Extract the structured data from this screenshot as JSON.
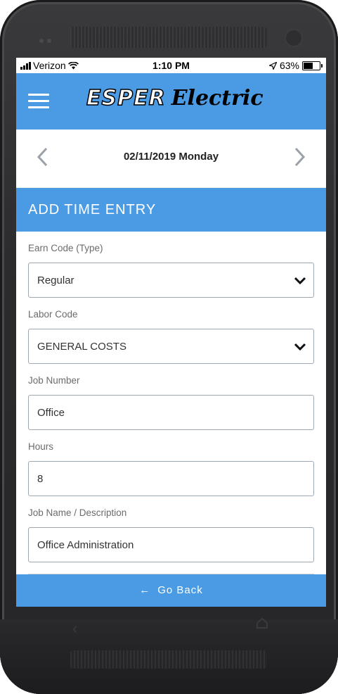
{
  "status_bar": {
    "carrier": "Verizon",
    "time": "1:10 PM",
    "battery_percent": "63%",
    "battery_level": 0.63
  },
  "header": {
    "logo_word1": "ESPER",
    "logo_word2": "Electric",
    "menu_icon": "hamburger-menu-icon",
    "accent_color": "#4a9be3"
  },
  "date_nav": {
    "date": "02/11/2019 Monday",
    "prev_icon": "chevron-left-icon",
    "next_icon": "chevron-right-icon"
  },
  "section": {
    "title": "ADD TIME ENTRY"
  },
  "form": {
    "earn_code": {
      "label": "Earn Code (Type)",
      "value": "Regular"
    },
    "labor_code": {
      "label": "Labor Code",
      "value": "GENERAL COSTS"
    },
    "job_number": {
      "label": "Job Number",
      "value": "Office"
    },
    "hours": {
      "label": "Hours",
      "value": "8"
    },
    "job_name": {
      "label": "Job Name / Description",
      "value": "Office Administration"
    }
  },
  "footer": {
    "go_back_label": "Go Back",
    "arrow_icon": "arrow-left-icon"
  }
}
